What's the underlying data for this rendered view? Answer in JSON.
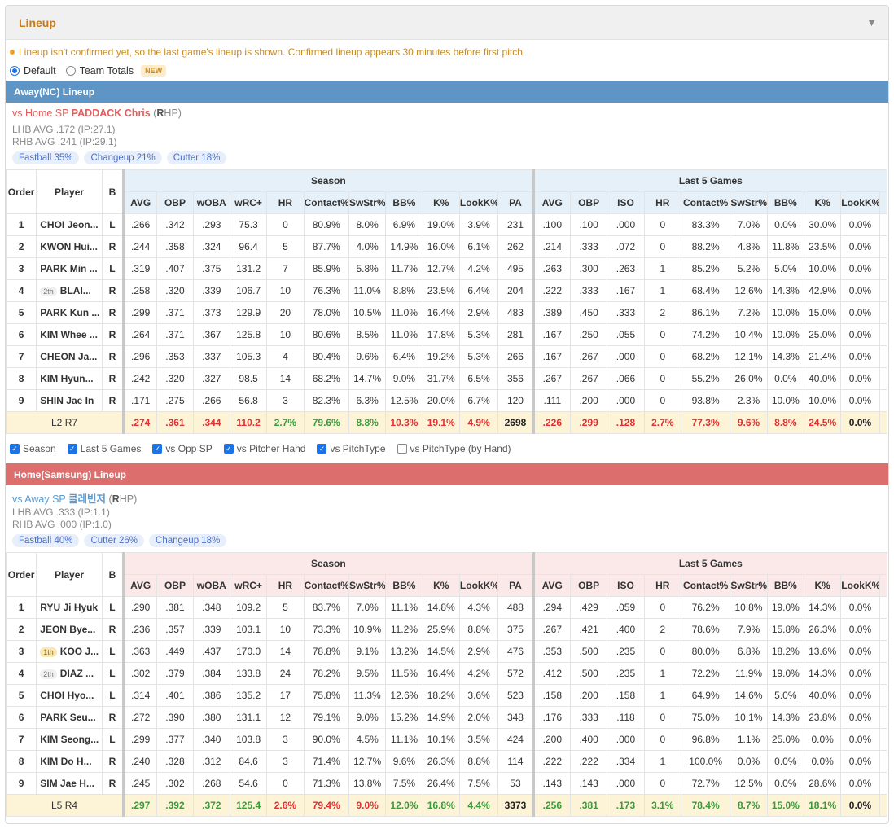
{
  "panel": {
    "title": "Lineup",
    "collapse_icon": "triangle-down-icon"
  },
  "notice": "Lineup isn't confirmed yet, so the last game's lineup is shown. Confirmed lineup appears 30 minutes before first pitch.",
  "modes": {
    "default": "Default",
    "team_totals": "Team Totals",
    "new": "NEW"
  },
  "headers": {
    "order": "Order",
    "player": "Player",
    "bat": "B",
    "season": "Season",
    "last5": "Last 5 Games",
    "season_cols": [
      "AVG",
      "OBP",
      "wOBA",
      "wRC+",
      "HR",
      "Contact%",
      "SwStr%",
      "BB%",
      "K%",
      "LookK%",
      "PA"
    ],
    "last5_cols": [
      "AVG",
      "OBP",
      "ISO",
      "HR",
      "Contact%",
      "SwStr%",
      "BB%",
      "K%",
      "LookK%"
    ]
  },
  "away": {
    "bar": "Away(NC) Lineup",
    "bar_color": "#5f95c4",
    "head_bg": "#e6f0f8",
    "sp_prefix": "vs Home SP",
    "sp_name": "PADDACK Chris",
    "sp_hand_bold": "R",
    "sp_hand_rest": "HP)",
    "sp_paren": "(",
    "sp_color": "#e35d5d",
    "lhb": "LHB AVG .172 (IP:27.1)",
    "rhb": "RHB AVG .241 (IP:29.1)",
    "pitches": [
      "Fastball 35%",
      "Changeup 21%",
      "Cutter 18%"
    ],
    "rows": [
      {
        "o": "1",
        "rank": "",
        "p": "CHOI Jeon...",
        "b": "L",
        "s": [
          ".266",
          ".342",
          ".293",
          "75.3",
          "0",
          "80.9%",
          "8.0%",
          "6.9%",
          "19.0%",
          "3.9%",
          "231"
        ],
        "l": [
          ".100",
          ".100",
          ".000",
          "0",
          "83.3%",
          "7.0%",
          "0.0%",
          "30.0%",
          "0.0%"
        ]
      },
      {
        "o": "2",
        "rank": "",
        "p": "KWON Hui...",
        "b": "R",
        "s": [
          ".244",
          ".358",
          ".324",
          "96.4",
          "5",
          "87.7%",
          "4.0%",
          "14.9%",
          "16.0%",
          "6.1%",
          "262"
        ],
        "l": [
          ".214",
          ".333",
          ".072",
          "0",
          "88.2%",
          "4.8%",
          "11.8%",
          "23.5%",
          "0.0%"
        ]
      },
      {
        "o": "3",
        "rank": "",
        "p": "PARK Min ...",
        "b": "L",
        "s": [
          ".319",
          ".407",
          ".375",
          "131.2",
          "7",
          "85.9%",
          "5.8%",
          "11.7%",
          "12.7%",
          "4.2%",
          "495"
        ],
        "l": [
          ".263",
          ".300",
          ".263",
          "1",
          "85.2%",
          "5.2%",
          "5.0%",
          "10.0%",
          "0.0%"
        ]
      },
      {
        "o": "4",
        "rank": "2th",
        "p": "BLAI...",
        "b": "R",
        "s": [
          ".258",
          ".320",
          ".339",
          "106.7",
          "10",
          "76.3%",
          "11.0%",
          "8.8%",
          "23.5%",
          "6.4%",
          "204"
        ],
        "l": [
          ".222",
          ".333",
          ".167",
          "1",
          "68.4%",
          "12.6%",
          "14.3%",
          "42.9%",
          "0.0%"
        ]
      },
      {
        "o": "5",
        "rank": "",
        "p": "PARK Kun ...",
        "b": "R",
        "s": [
          ".299",
          ".371",
          ".373",
          "129.9",
          "20",
          "78.0%",
          "10.5%",
          "11.0%",
          "16.4%",
          "2.9%",
          "483"
        ],
        "l": [
          ".389",
          ".450",
          ".333",
          "2",
          "86.1%",
          "7.2%",
          "10.0%",
          "15.0%",
          "0.0%"
        ]
      },
      {
        "o": "6",
        "rank": "",
        "p": "KIM Whee ...",
        "b": "R",
        "s": [
          ".264",
          ".371",
          ".367",
          "125.8",
          "10",
          "80.6%",
          "8.5%",
          "11.0%",
          "17.8%",
          "5.3%",
          "281"
        ],
        "l": [
          ".167",
          ".250",
          ".055",
          "0",
          "74.2%",
          "10.4%",
          "10.0%",
          "25.0%",
          "0.0%"
        ]
      },
      {
        "o": "7",
        "rank": "",
        "p": "CHEON Ja...",
        "b": "R",
        "s": [
          ".296",
          ".353",
          ".337",
          "105.3",
          "4",
          "80.4%",
          "9.6%",
          "6.4%",
          "19.2%",
          "5.3%",
          "266"
        ],
        "l": [
          ".167",
          ".267",
          ".000",
          "0",
          "68.2%",
          "12.1%",
          "14.3%",
          "21.4%",
          "0.0%"
        ]
      },
      {
        "o": "8",
        "rank": "",
        "p": "KIM Hyun...",
        "b": "R",
        "s": [
          ".242",
          ".320",
          ".327",
          "98.5",
          "14",
          "68.2%",
          "14.7%",
          "9.0%",
          "31.7%",
          "6.5%",
          "356"
        ],
        "l": [
          ".267",
          ".267",
          ".066",
          "0",
          "55.2%",
          "26.0%",
          "0.0%",
          "40.0%",
          "0.0%"
        ]
      },
      {
        "o": "9",
        "rank": "",
        "p": "SHIN Jae In",
        "b": "R",
        "s": [
          ".171",
          ".275",
          ".266",
          "56.8",
          "3",
          "82.3%",
          "6.3%",
          "12.5%",
          "20.0%",
          "6.7%",
          "120"
        ],
        "l": [
          ".111",
          ".200",
          ".000",
          "0",
          "93.8%",
          "2.3%",
          "10.0%",
          "10.0%",
          "0.0%"
        ]
      }
    ],
    "total": {
      "label_a": "L2 ",
      "label_b": "R7",
      "s": [
        ".274",
        ".361",
        ".344",
        "110.2",
        "2.7%",
        "79.6%",
        "8.8%",
        "10.3%",
        "19.1%",
        "4.9%",
        "2698"
      ],
      "s_cls": [
        "neg",
        "neg",
        "neg",
        "neg",
        "pos",
        "pos",
        "pos",
        "neg",
        "neg",
        "neg",
        "neu"
      ],
      "l": [
        ".226",
        ".299",
        ".128",
        "2.7%",
        "77.3%",
        "9.6%",
        "8.8%",
        "24.5%",
        "0.0%"
      ],
      "l_cls": [
        "neg",
        "neg",
        "neg",
        "neg",
        "neg",
        "neg",
        "neg",
        "neg",
        "neu"
      ]
    }
  },
  "checks": [
    "Season",
    "Last 5 Games",
    "vs Opp SP",
    "vs Pitcher Hand",
    "vs PitchType",
    "vs PitchType (by Hand)"
  ],
  "checks_on": [
    true,
    true,
    true,
    true,
    true,
    false
  ],
  "home": {
    "bar": "Home(Samsung) Lineup",
    "bar_color": "#dd6e6e",
    "head_bg": "#fbe9e9",
    "sp_prefix": "vs Away SP",
    "sp_name": "클레빈저",
    "sp_hand_bold": "R",
    "sp_hand_rest": "HP)",
    "sp_paren": "(",
    "sp_color": "#5a9ad0",
    "lhb": "LHB AVG .333 (IP:1.1)",
    "rhb": "RHB AVG .000 (IP:1.0)",
    "pitches": [
      "Fastball 40%",
      "Cutter 26%",
      "Changeup 18%"
    ],
    "rows": [
      {
        "o": "1",
        "rank": "",
        "p": "RYU Ji Hyuk",
        "b": "L",
        "s": [
          ".290",
          ".381",
          ".348",
          "109.2",
          "5",
          "83.7%",
          "7.0%",
          "11.1%",
          "14.8%",
          "4.3%",
          "488"
        ],
        "l": [
          ".294",
          ".429",
          ".059",
          "0",
          "76.2%",
          "10.8%",
          "19.0%",
          "14.3%",
          "0.0%"
        ]
      },
      {
        "o": "2",
        "rank": "",
        "p": "JEON Bye...",
        "b": "R",
        "s": [
          ".236",
          ".357",
          ".339",
          "103.1",
          "10",
          "73.3%",
          "10.9%",
          "11.2%",
          "25.9%",
          "8.8%",
          "375"
        ],
        "l": [
          ".267",
          ".421",
          ".400",
          "2",
          "78.6%",
          "7.9%",
          "15.8%",
          "26.3%",
          "0.0%"
        ]
      },
      {
        "o": "3",
        "rank": "1th",
        "p": "KOO J...",
        "b": "L",
        "s": [
          ".363",
          ".449",
          ".437",
          "170.0",
          "14",
          "78.8%",
          "9.1%",
          "13.2%",
          "14.5%",
          "2.9%",
          "476"
        ],
        "l": [
          ".353",
          ".500",
          ".235",
          "0",
          "80.0%",
          "6.8%",
          "18.2%",
          "13.6%",
          "0.0%"
        ]
      },
      {
        "o": "4",
        "rank": "2th",
        "p": "DIAZ ...",
        "b": "L",
        "s": [
          ".302",
          ".379",
          ".384",
          "133.8",
          "24",
          "78.2%",
          "9.5%",
          "11.5%",
          "16.4%",
          "4.2%",
          "572"
        ],
        "l": [
          ".412",
          ".500",
          ".235",
          "1",
          "72.2%",
          "11.9%",
          "19.0%",
          "14.3%",
          "0.0%"
        ]
      },
      {
        "o": "5",
        "rank": "",
        "p": "CHOI Hyo...",
        "b": "L",
        "s": [
          ".314",
          ".401",
          ".386",
          "135.2",
          "17",
          "75.8%",
          "11.3%",
          "12.6%",
          "18.2%",
          "3.6%",
          "523"
        ],
        "l": [
          ".158",
          ".200",
          ".158",
          "1",
          "64.9%",
          "14.6%",
          "5.0%",
          "40.0%",
          "0.0%"
        ]
      },
      {
        "o": "6",
        "rank": "",
        "p": "PARK Seu...",
        "b": "R",
        "s": [
          ".272",
          ".390",
          ".380",
          "131.1",
          "12",
          "79.1%",
          "9.0%",
          "15.2%",
          "14.9%",
          "2.0%",
          "348"
        ],
        "l": [
          ".176",
          ".333",
          ".118",
          "0",
          "75.0%",
          "10.1%",
          "14.3%",
          "23.8%",
          "0.0%"
        ]
      },
      {
        "o": "7",
        "rank": "",
        "p": "KIM Seong...",
        "b": "L",
        "s": [
          ".299",
          ".377",
          ".340",
          "103.8",
          "3",
          "90.0%",
          "4.5%",
          "11.1%",
          "10.1%",
          "3.5%",
          "424"
        ],
        "l": [
          ".200",
          ".400",
          ".000",
          "0",
          "96.8%",
          "1.1%",
          "25.0%",
          "0.0%",
          "0.0%"
        ]
      },
      {
        "o": "8",
        "rank": "",
        "p": "KIM Do H...",
        "b": "R",
        "s": [
          ".240",
          ".328",
          ".312",
          "84.6",
          "3",
          "71.4%",
          "12.7%",
          "9.6%",
          "26.3%",
          "8.8%",
          "114"
        ],
        "l": [
          ".222",
          ".222",
          ".334",
          "1",
          "100.0%",
          "0.0%",
          "0.0%",
          "0.0%",
          "0.0%"
        ]
      },
      {
        "o": "9",
        "rank": "",
        "p": "SIM Jae H...",
        "b": "R",
        "s": [
          ".245",
          ".302",
          ".268",
          "54.6",
          "0",
          "71.3%",
          "13.8%",
          "7.5%",
          "26.4%",
          "7.5%",
          "53"
        ],
        "l": [
          ".143",
          ".143",
          ".000",
          "0",
          "72.7%",
          "12.5%",
          "0.0%",
          "28.6%",
          "0.0%"
        ]
      }
    ],
    "total": {
      "label_a": "L5 ",
      "label_b": "R4",
      "s": [
        ".297",
        ".392",
        ".372",
        "125.4",
        "2.6%",
        "79.4%",
        "9.0%",
        "12.0%",
        "16.8%",
        "4.4%",
        "3373"
      ],
      "s_cls": [
        "pos",
        "pos",
        "pos",
        "pos",
        "neg",
        "neg",
        "neg",
        "pos",
        "pos",
        "pos",
        "neu"
      ],
      "l": [
        ".256",
        ".381",
        ".173",
        "3.1%",
        "78.4%",
        "8.7%",
        "15.0%",
        "18.1%",
        "0.0%"
      ],
      "l_cls": [
        "pos",
        "pos",
        "pos",
        "pos",
        "pos",
        "pos",
        "pos",
        "pos",
        "neu"
      ]
    }
  }
}
